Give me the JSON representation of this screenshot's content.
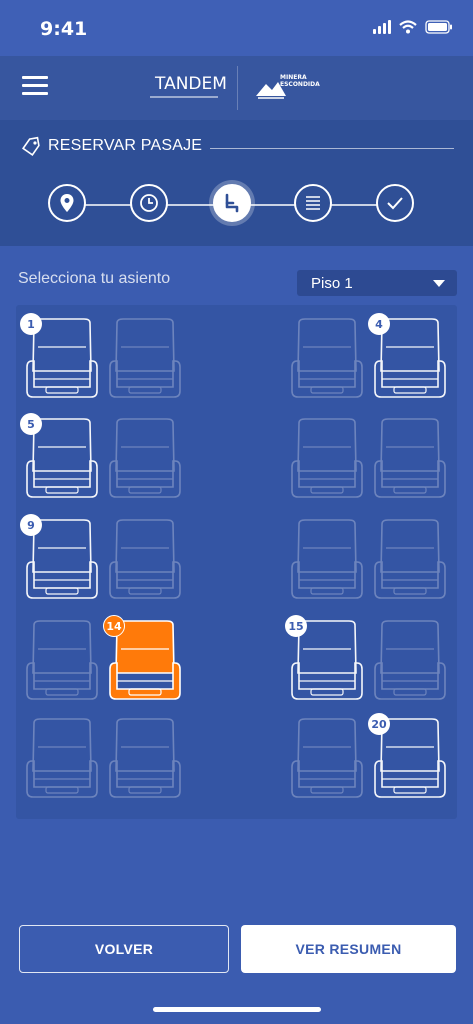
{
  "status_bar": {
    "time": "9:41"
  },
  "header": {
    "brand_left": "TANDEM",
    "brand_right_line1": "MINERA",
    "brand_right_line2": "ESCONDIDA"
  },
  "booking": {
    "title": "RESERVAR PASAJE",
    "steps": [
      {
        "icon": "location-pin-icon",
        "state": "done"
      },
      {
        "icon": "clock-icon",
        "state": "done"
      },
      {
        "icon": "seat-icon",
        "state": "active"
      },
      {
        "icon": "list-icon",
        "state": "pending"
      },
      {
        "icon": "check-icon",
        "state": "pending"
      }
    ]
  },
  "seat_selection": {
    "label": "Selecciona tu asiento",
    "floor": "Piso 1",
    "seats": [
      {
        "number": "1",
        "row": 0,
        "col": 0,
        "status": "available"
      },
      {
        "number": "",
        "row": 0,
        "col": 1,
        "status": "occupied"
      },
      {
        "number": "",
        "row": 0,
        "col": 2,
        "status": "occupied"
      },
      {
        "number": "4",
        "row": 0,
        "col": 3,
        "status": "available"
      },
      {
        "number": "5",
        "row": 1,
        "col": 0,
        "status": "available"
      },
      {
        "number": "",
        "row": 1,
        "col": 1,
        "status": "occupied"
      },
      {
        "number": "",
        "row": 1,
        "col": 2,
        "status": "occupied"
      },
      {
        "number": "",
        "row": 1,
        "col": 3,
        "status": "occupied"
      },
      {
        "number": "9",
        "row": 2,
        "col": 0,
        "status": "available"
      },
      {
        "number": "",
        "row": 2,
        "col": 1,
        "status": "occupied"
      },
      {
        "number": "",
        "row": 2,
        "col": 2,
        "status": "occupied"
      },
      {
        "number": "",
        "row": 2,
        "col": 3,
        "status": "occupied"
      },
      {
        "number": "",
        "row": 3,
        "col": 0,
        "status": "occupied"
      },
      {
        "number": "14",
        "row": 3,
        "col": 1,
        "status": "selected"
      },
      {
        "number": "15",
        "row": 3,
        "col": 2,
        "status": "available"
      },
      {
        "number": "",
        "row": 3,
        "col": 3,
        "status": "occupied"
      },
      {
        "number": "",
        "row": 4,
        "col": 0,
        "status": "occupied"
      },
      {
        "number": "",
        "row": 4,
        "col": 1,
        "status": "occupied"
      },
      {
        "number": "",
        "row": 4,
        "col": 2,
        "status": "occupied"
      },
      {
        "number": "20",
        "row": 4,
        "col": 3,
        "status": "available"
      }
    ]
  },
  "actions": {
    "back_label": "VOLVER",
    "summary_label": "VER RESUMEN"
  },
  "colors": {
    "background": "#3b5cb0",
    "selected_seat": "#ff7a0a",
    "accent": "#ffffff"
  }
}
